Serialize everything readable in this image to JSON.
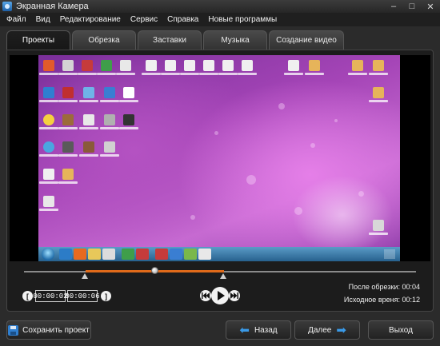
{
  "window": {
    "title": "Экранная Камера",
    "controls": [
      "–",
      "□",
      "✕"
    ]
  },
  "menu": [
    "Файл",
    "Вид",
    "Редактирование",
    "Сервис",
    "Справка",
    "Новые программы"
  ],
  "tabs": [
    {
      "label": "Проекты",
      "active": true
    },
    {
      "label": "Обрезка",
      "active": false
    },
    {
      "label": "Заставки",
      "active": false
    },
    {
      "label": "Музыка",
      "active": false
    },
    {
      "label": "Создание видео",
      "active": false
    }
  ],
  "timeline": {
    "playhead_position": 0.33,
    "selection_start": 0.16,
    "selection_end": 0.51
  },
  "trim": {
    "start_time": "00:00:02",
    "end_time": "00:00:06",
    "left_bracket": "[",
    "right_bracket": "]"
  },
  "info": {
    "after_trim_label": "После обрезки:",
    "after_trim_value": "00:04",
    "source_time_label": "Исходное вреня:",
    "source_time_value": "00:12"
  },
  "buttons": {
    "save": "Сохранить проект",
    "back": "Назад",
    "next": "Далее",
    "exit": "Выход"
  },
  "icons": [
    "app-icon",
    "play-icon",
    "prev-icon",
    "next-icon",
    "save-icon",
    "back-arrow-icon",
    "next-arrow-icon"
  ],
  "colors": {
    "accent": "#e06a1a",
    "arrow": "#3a9ae8",
    "desktop_purple": "#b452c2"
  }
}
